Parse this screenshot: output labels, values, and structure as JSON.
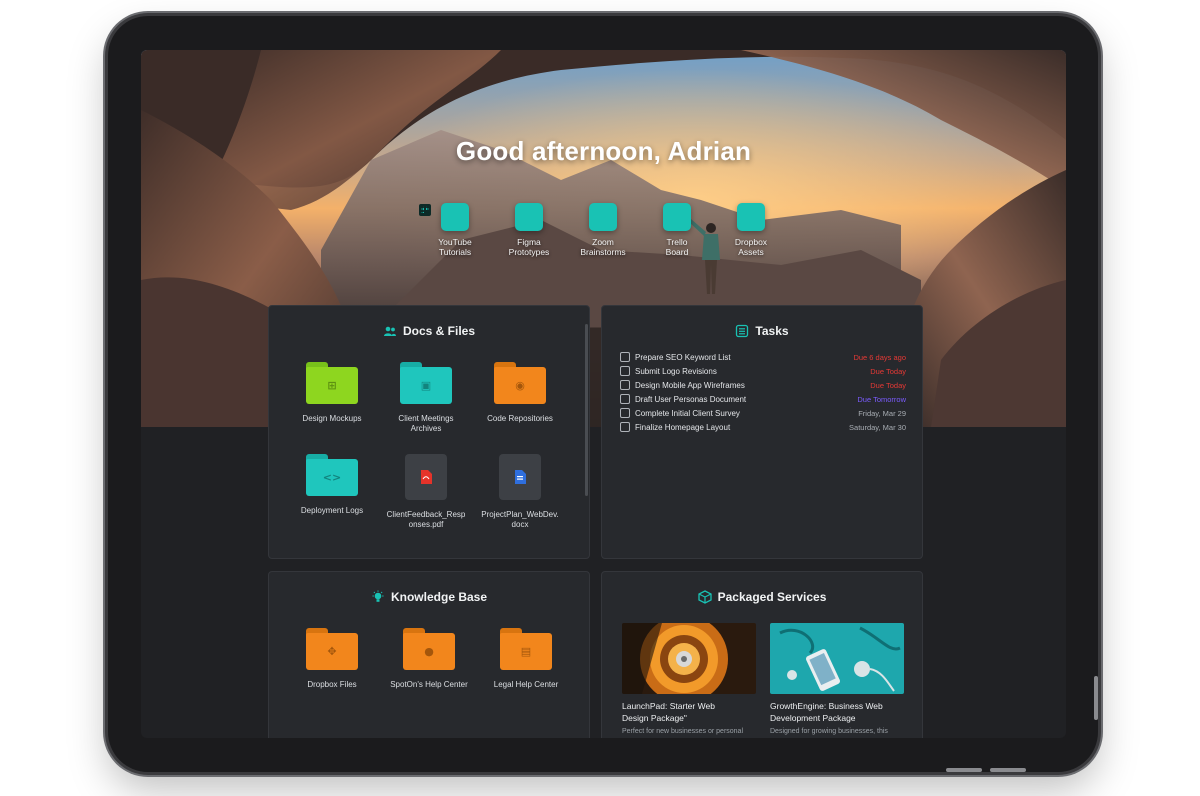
{
  "header": {
    "greeting": "Good afternoon, Adrian"
  },
  "quick_links": [
    {
      "label": "YouTube\nTutorials",
      "icon": "youtube-icon"
    },
    {
      "label": "Figma\nPrototypes",
      "icon": "figma-icon"
    },
    {
      "label": "Zoom\nBrainstorms",
      "icon": "video-icon"
    },
    {
      "label": "Trello\nBoard",
      "icon": "trello-icon"
    },
    {
      "label": "Dropbox\nAssets",
      "icon": "dropbox-icon"
    }
  ],
  "docs": {
    "title": "Docs & Files",
    "items": [
      {
        "label": "Design Mockups",
        "kind": "folder",
        "color": "#8ed61f"
      },
      {
        "label": "Client Meetings\nArchives",
        "kind": "folder",
        "color": "#1fc6bd"
      },
      {
        "label": "Code Repositories",
        "kind": "folder",
        "color": "#f2861c"
      },
      {
        "label": "Deployment Logs",
        "kind": "folder",
        "color": "#1fc6bd"
      },
      {
        "label": "ClientFeedback_Resp\nonses.pdf",
        "kind": "pdf",
        "color": "#e5332a"
      },
      {
        "label": "ProjectPlan_WebDev.\ndocx",
        "kind": "doc",
        "color": "#2f6fde"
      }
    ]
  },
  "tasks": {
    "title": "Tasks",
    "items": [
      {
        "name": "Prepare SEO Keyword List",
        "due": "Due 6 days ago",
        "color": "#e53935"
      },
      {
        "name": "Submit Logo Revisions",
        "due": "Due Today",
        "color": "#e53935"
      },
      {
        "name": "Design Mobile App Wireframes",
        "due": "Due Today",
        "color": "#e53935"
      },
      {
        "name": "Draft User Personas Document",
        "due": "Due Tomorrow",
        "color": "#7b5cff"
      },
      {
        "name": "Complete Initial Client Survey",
        "due": "Friday, Mar 29",
        "color": "#a8adb3"
      },
      {
        "name": "Finalize Homepage Layout",
        "due": "Saturday, Mar 30",
        "color": "#a8adb3"
      }
    ]
  },
  "knowledge": {
    "title": "Knowledge Base",
    "items": [
      {
        "label": "Dropbox Files",
        "color": "#f2861c"
      },
      {
        "label": "SpotOn's Help Center",
        "color": "#f2861c"
      },
      {
        "label": "Legal Help Center",
        "color": "#f2861c"
      }
    ]
  },
  "services": {
    "title": "Packaged Services",
    "items": [
      {
        "title": "LaunchPad: Starter Web\nDesign Package\"",
        "desc": "Perfect for new businesses or personal"
      },
      {
        "title": "GrowthEngine: Business Web\nDevelopment Package",
        "desc": "Designed for growing businesses, this"
      }
    ]
  },
  "colors": {
    "accent": "#19c2b4",
    "panel": "#27292d",
    "background": "#202124"
  }
}
